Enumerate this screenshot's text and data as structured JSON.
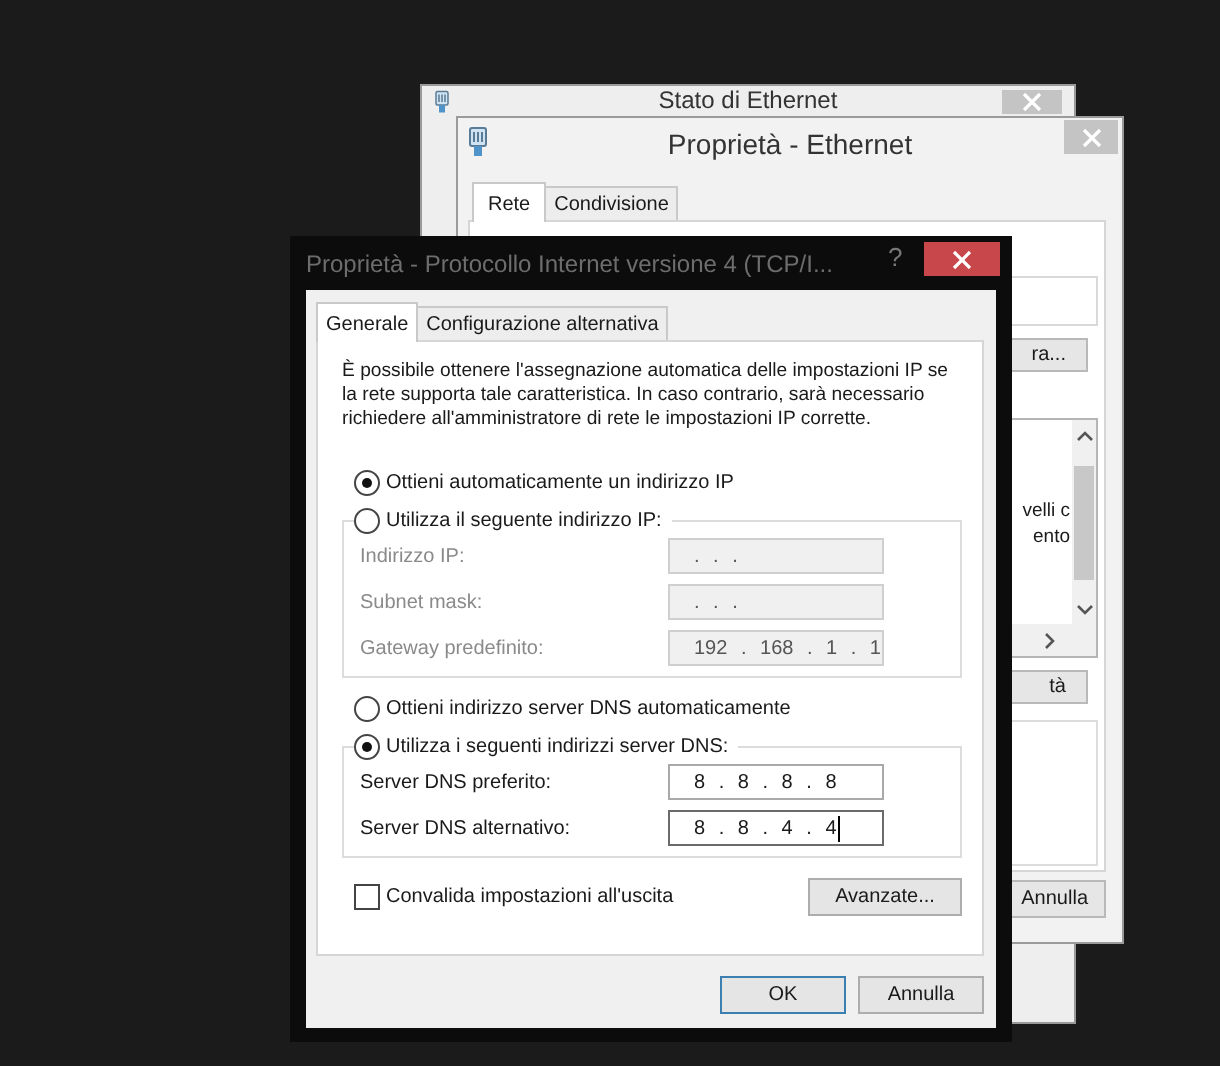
{
  "status_window": {
    "title": "Stato di Ethernet"
  },
  "ethernet_window": {
    "title": "Proprietà - Ethernet",
    "tabs": [
      {
        "label": "Rete",
        "selected": true
      },
      {
        "label": "Condivisione",
        "selected": false
      }
    ],
    "configure_button": "ra...",
    "list_lines": [
      "velli c",
      "ento"
    ],
    "properties_button": "tà",
    "cancel_button": "Annulla"
  },
  "dialog": {
    "title": "Proprietà - Protocollo Internet versione 4 (TCP/I...",
    "help": "?",
    "tabs": [
      {
        "label": "Generale",
        "selected": true
      },
      {
        "label": "Configurazione alternativa",
        "selected": false
      }
    ],
    "description": "È possibile ottenere l'assegnazione automatica delle impostazioni IP se la rete supporta tale caratteristica. In caso contrario, sarà necessario richiedere all'amministratore di rete le impostazioni IP corrette.",
    "ip_auto": {
      "label": "Ottieni automaticamente un indirizzo IP",
      "selected": true
    },
    "ip_manual": {
      "label": "Utilizza il seguente indirizzo IP:",
      "selected": false
    },
    "ip_fields": [
      {
        "label": "Indirizzo IP:",
        "value": ". . .",
        "disabled": true,
        "focused": false
      },
      {
        "label": "Subnet mask:",
        "value": ". . .",
        "disabled": true,
        "focused": false
      },
      {
        "label": "Gateway predefinito:",
        "value": "192 . 168 . 1 . 1",
        "disabled": true,
        "focused": false
      }
    ],
    "dns_auto": {
      "label": "Ottieni indirizzo server DNS automaticamente",
      "selected": false
    },
    "dns_manual": {
      "label": "Utilizza i seguenti indirizzi server DNS:",
      "selected": true
    },
    "dns_fields": [
      {
        "label": "Server DNS preferito:",
        "value": "8 . 8 . 8 . 8",
        "disabled": false,
        "focused": false
      },
      {
        "label": "Server DNS alternativo:",
        "value": "8 . 8 . 4 . 4",
        "disabled": false,
        "focused": true
      }
    ],
    "validate": {
      "label": "Convalida impostazioni all'uscita",
      "checked": false
    },
    "advanced_button": "Avanzate...",
    "buttons": [
      {
        "label": "OK",
        "default": true
      },
      {
        "label": "Annulla",
        "default": false
      }
    ]
  }
}
